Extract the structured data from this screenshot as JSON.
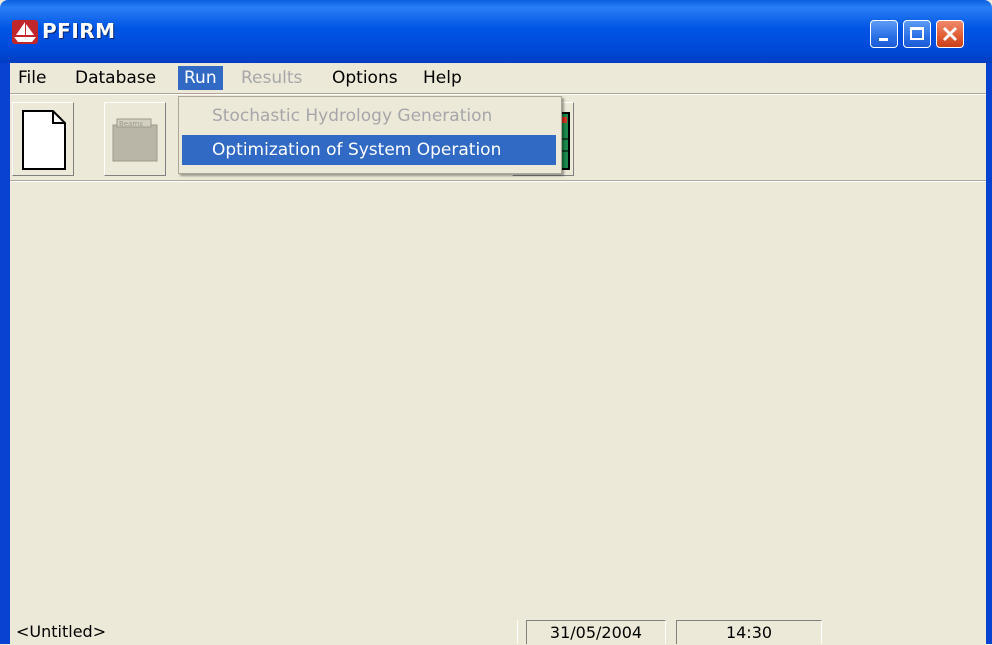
{
  "window": {
    "title": "PFIRM",
    "app_icon": "sailboat-icon",
    "controls": [
      "minimize-icon",
      "maximize-icon",
      "close-icon"
    ]
  },
  "menubar": {
    "file": "File",
    "database": "Database",
    "run": "Run",
    "results": "Results",
    "options": "Options",
    "help": "Help"
  },
  "run_menu": {
    "items": [
      {
        "label": "Stochastic Hydrology Generation",
        "state": "disabled"
      },
      {
        "label": "Optimization of System Operation",
        "state": "highlighted"
      }
    ]
  },
  "toolbar": {
    "buttons": [
      "new-document-icon",
      "open-folder-icon",
      "toolbar-icon-3",
      "toolbar-icon-4",
      "toolbar-icon-5",
      "grid-chart-icon"
    ]
  },
  "statusbar": {
    "document": "<Untitled>",
    "date": "31/05/2004",
    "time": "14:30"
  },
  "colors": {
    "titlebar": "#0055e5",
    "menu_highlight": "#316ac5",
    "face": "#ece9d8",
    "close_button": "#e05a32",
    "disabled_text": "#a7a6aa"
  }
}
